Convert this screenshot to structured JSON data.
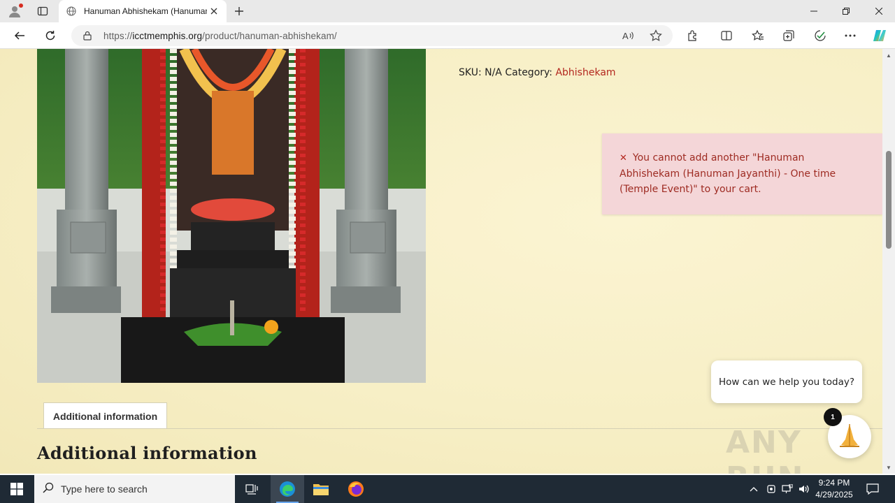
{
  "browser": {
    "tab_title": "Hanuman Abhishekam (Hanuman",
    "url_prefix": "https://",
    "url_domain": "icctmemphis.org",
    "url_path": "/product/hanuman-abhishekam/"
  },
  "product": {
    "sku_label": "SKU:",
    "sku_value": "N/A",
    "category_label": "Category:",
    "category_value": "Abhishekam"
  },
  "notice": {
    "icon": "close-icon",
    "message": "You cannot add another \"Hanuman Abhishekam (Hanuman Jayanthi) - One time (Temple Event)\" to your cart."
  },
  "tabs": {
    "additional_information": "Additional information"
  },
  "section": {
    "heading": "Additional information"
  },
  "chat": {
    "prompt": "How can we help you today?",
    "badge_count": "1"
  },
  "watermark": "ANY RUN",
  "taskbar": {
    "search_placeholder": "Type here to search",
    "time": "9:24 PM",
    "date": "4/29/2025"
  },
  "colors": {
    "accent_red": "#b3261e",
    "notice_bg": "#f4d6d8",
    "page_bg": "#f7efc6",
    "taskbar_bg": "#1f2a35"
  }
}
